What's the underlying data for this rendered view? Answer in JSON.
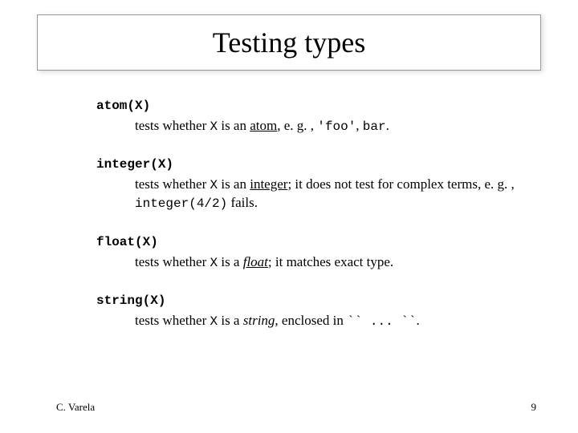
{
  "title": "Testing types",
  "entries": {
    "atom": {
      "term": "atom(X)",
      "d_pre": "tests whether ",
      "d_code1": "X",
      "d_mid1": " is an ",
      "d_ul": "atom",
      "d_mid2": ", e. g. , ",
      "d_code2": "'foo'",
      "d_mid3": ", ",
      "d_code3": "bar",
      "d_end": "."
    },
    "integer": {
      "term": "integer(X)",
      "d_pre": "tests whether ",
      "d_code1": "X",
      "d_mid1": " is an ",
      "d_ul": "integer",
      "d_mid2": "; it does not test for complex terms, e. g. , ",
      "d_code2": "integer(4/2)",
      "d_end": " fails."
    },
    "float": {
      "term": "float(X)",
      "d_pre": "tests whether ",
      "d_code1": "X",
      "d_mid1": " is a ",
      "d_ul": "float",
      "d_end": "; it matches exact type."
    },
    "string": {
      "term": "string(X)",
      "d_pre": "tests whether ",
      "d_code1": "X",
      "d_mid1": " is a ",
      "d_ul": "string",
      "d_mid2": ", enclosed in ",
      "d_code2": "`` ... ``",
      "d_end": "."
    }
  },
  "footer": {
    "author": "C. Varela",
    "page": "9"
  }
}
